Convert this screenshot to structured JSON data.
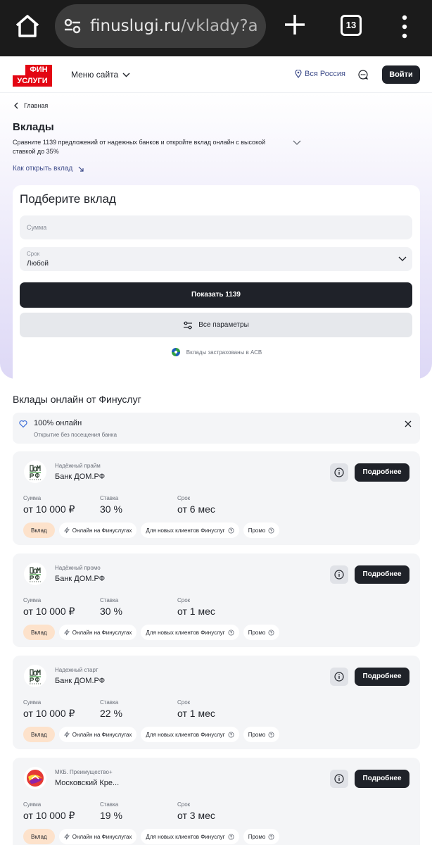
{
  "browser": {
    "url_host": "finuslugi.ru",
    "url_path": "/vklady?a",
    "tab_count": "13"
  },
  "header": {
    "logo_top": "ФИН",
    "logo_bottom": "УСЛУГИ",
    "menu_label": "Меню сайта",
    "region_label": "Вся Россия",
    "login_label": "Войти"
  },
  "hero": {
    "breadcrumb": "Главная",
    "title": "Вклады",
    "lead": "Сравните 1139 предложений от надежных банков и откройте вклад онлайн с высокой ставкой до 35%",
    "how_link": "Как открыть вклад"
  },
  "filter": {
    "title": "Подберите вклад",
    "sum_placeholder": "Сумма",
    "term_label": "Срок",
    "term_value": "Любой",
    "show_button": "Показать 1139",
    "params_button": "Все параметры",
    "insured_text": "Вклады застрахованы в АСВ"
  },
  "section": {
    "title": "Вклады онлайн от Финуслуг"
  },
  "banner": {
    "title": "100% онлайн",
    "subtitle": "Открытие без посещения банка"
  },
  "labels": {
    "sum": "Сумма",
    "rate": "Ставка",
    "term": "Срок",
    "more": "Подробнее"
  },
  "tags": {
    "deposit": "Вклад",
    "online": "Онлайн на Финуслугах",
    "new_clients": "Для новых клиентов Финуслуг",
    "promo": "Промо"
  },
  "offers": [
    {
      "product": "Надёжный прайм",
      "bank": "Банк ДОМ.РФ",
      "sum": "от 10 000 ₽",
      "rate": "30 %",
      "term": "от 6 мес",
      "logo": "dom-rf-logo"
    },
    {
      "product": "Надёжный промо",
      "bank": "Банк ДОМ.РФ",
      "sum": "от 10 000 ₽",
      "rate": "30 %",
      "term": "от 1 мес",
      "logo": "dom-rf-logo"
    },
    {
      "product": "Надежный старт",
      "bank": "Банк ДОМ.РФ",
      "sum": "от 10 000 ₽",
      "rate": "22 %",
      "term": "от 1 мес",
      "logo": "dom-rf-logo"
    },
    {
      "product": "МКБ. Преимущество+",
      "bank": "Московский Кре...",
      "sum": "от 10 000 ₽",
      "rate": "19 %",
      "term": "от 3 мес",
      "logo": "mkb-logo"
    }
  ],
  "colors": {
    "brand_red": "#e30613",
    "dark_button": "#1f2229",
    "link_blue": "#3e4c8a",
    "deposit_tag": "#fde2cb"
  }
}
